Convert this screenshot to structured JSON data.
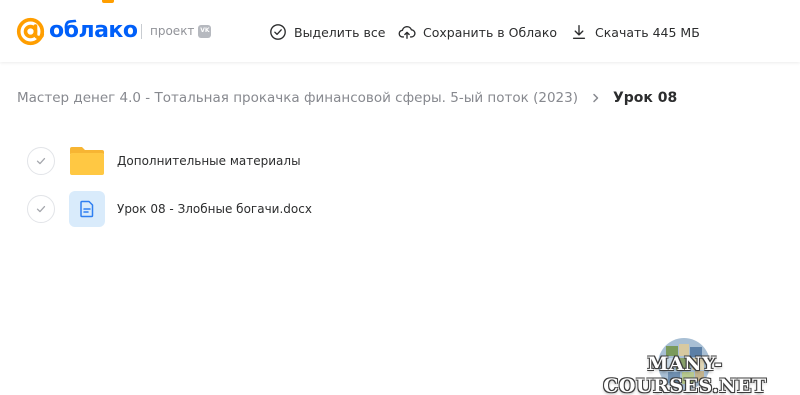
{
  "app": {
    "logo_text": "облако",
    "project_label": "проект",
    "vk_badge": "VK",
    "brand_color": "#005ff9",
    "accent_color": "#ff9e00"
  },
  "toolbar": {
    "select_all": {
      "label": "Выделить все",
      "icon": "check-circle-icon"
    },
    "save_to_cloud": {
      "label": "Сохранить в Облако",
      "icon": "cloud-upload-icon"
    },
    "download": {
      "label": "Скачать 445 МБ",
      "icon": "download-icon"
    }
  },
  "breadcrumb": {
    "parent": "Мастер денег 4.0 - Тотальная прокачка финансовой сферы. 5-ый поток (2023)",
    "current": "Урок 08"
  },
  "files": [
    {
      "name": "Дополнительные материалы",
      "type": "folder",
      "icon": "folder-icon"
    },
    {
      "name": "Урок 08 - Злобные богачи.docx",
      "type": "document",
      "icon": "document-icon"
    }
  ],
  "watermark": {
    "text": "MANY-COURSES.NET"
  }
}
